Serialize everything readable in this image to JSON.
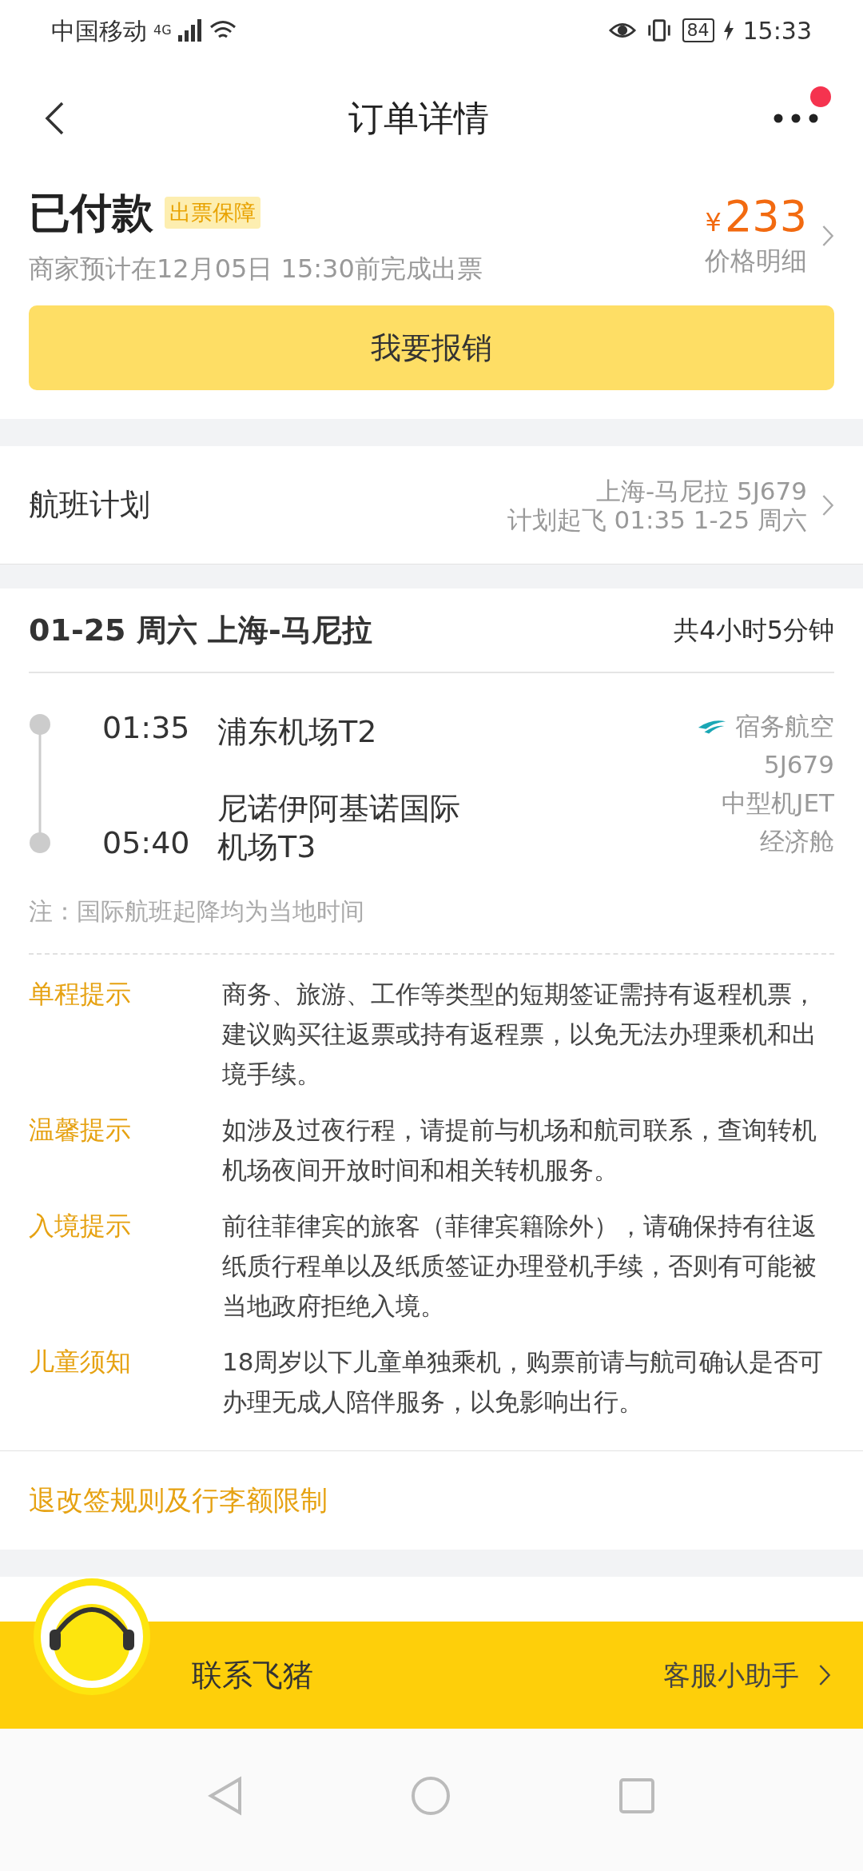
{
  "status_bar": {
    "carrier": "中国移动",
    "network": "4G",
    "battery": "84",
    "time": "15:33"
  },
  "header": {
    "title": "订单详情",
    "unread": true
  },
  "order": {
    "status": "已付款",
    "tag": "出票保障",
    "note": "商家预计在12月05日 15:30前完成出票",
    "currency": "¥",
    "price": "233",
    "price_link": "价格明细",
    "button": "我要报销"
  },
  "flight_plan": {
    "label": "航班计划",
    "route": "上海-马尼拉 5J679",
    "departure": "计划起飞 01:35 1-25 周六"
  },
  "segment": {
    "title": "01-25 周六 上海-马尼拉",
    "duration": "共4小时5分钟",
    "stops": [
      {
        "time": "01:35",
        "airport": "浦东机场T2"
      },
      {
        "time": "05:40",
        "airport": "尼诺伊阿基诺国际机场T3"
      }
    ],
    "airline": "宿务航空",
    "flight_no": "5J679",
    "aircraft": "中型机JET",
    "cabin": "经济舱",
    "note": "注：国际航班起降均为当地时间"
  },
  "tips": [
    {
      "label": "单程提示",
      "text": "商务、旅游、工作等类型的短期签证需持有返程机票，建议购买往返票或持有返程票，以免无法办理乘机和出境手续。"
    },
    {
      "label": "温馨提示",
      "text": "如涉及过夜行程，请提前与机场和航司联系，查询转机机场夜间开放时间和相关转机服务。"
    },
    {
      "label": "入境提示",
      "text": "前往菲律宾的旅客（菲律宾籍除外），请确保持有往返纸质行程单以及纸质签证办理登机手续，否则有可能被当地政府拒绝入境。"
    },
    {
      "label": "儿童须知",
      "text": "18周岁以下儿童单独乘机，购票前请与航司确认是否可办理无成人陪伴服务，以免影响出行。"
    }
  ],
  "rules_link": "退改签规则及行李额限制",
  "contact": {
    "title": "联系飞猪",
    "assistant": "客服小助手"
  }
}
